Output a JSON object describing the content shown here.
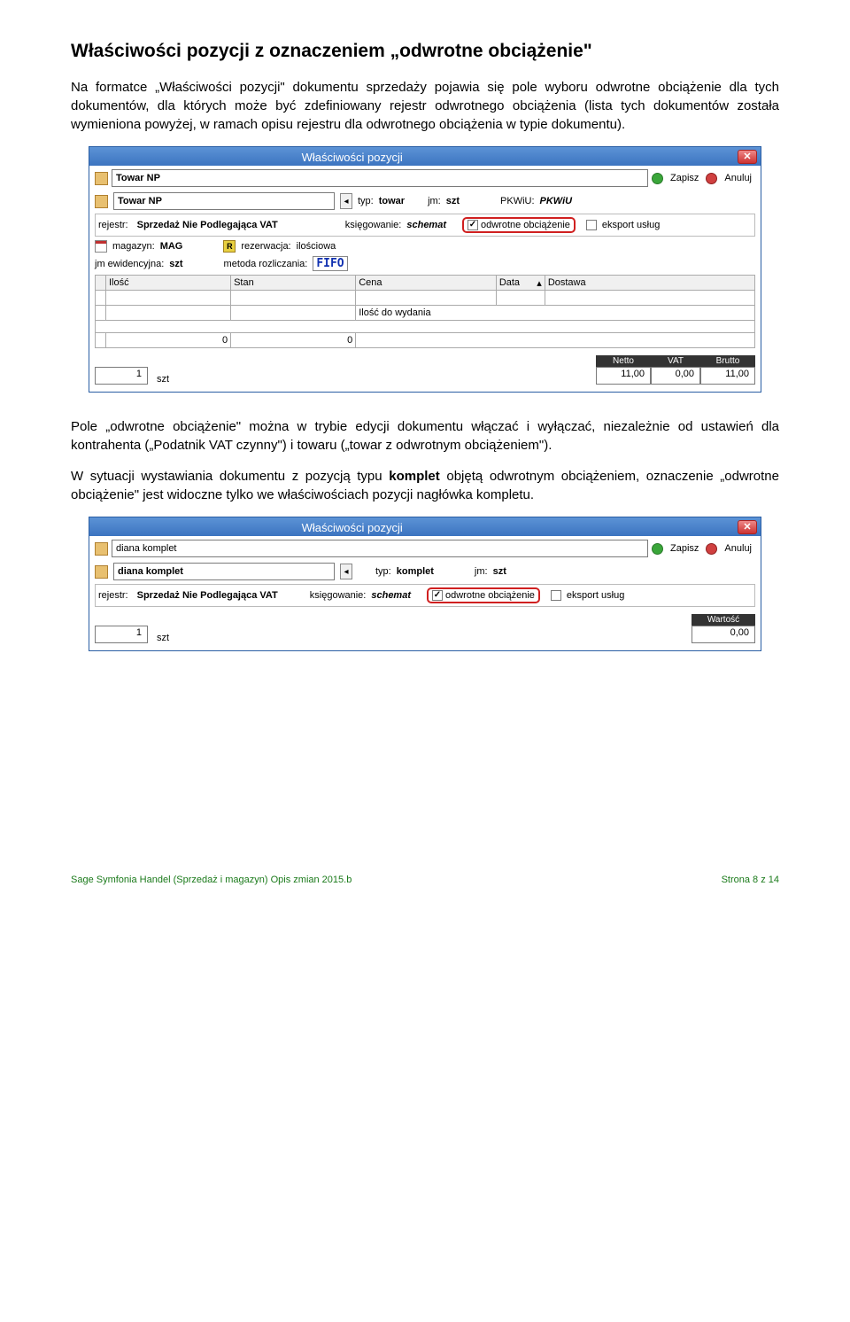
{
  "heading": "Właściwości pozycji z oznaczeniem „odwrotne obciążenie\"",
  "para1": "Na formatce „Właściwości pozycji\" dokumentu sprzedaży pojawia się pole wyboru odwrotne obciążenie dla tych dokumentów, dla których może być zdefiniowany rejestr odwrotnego obciążenia (lista tych dokumentów została wymieniona powyżej, w ramach opisu rejestru dla odwrotnego obciążenia w typie dokumentu).",
  "para2": "Pole „odwrotne obciążenie\" można w trybie edycji dokumentu włączać i wyłączać, niezależnie od ustawień dla kontrahenta („Podatnik VAT czynny\") i towaru („towar z odwrotnym obciążeniem\").",
  "para3_pre": "W sytuacji wystawiania dokumentu z pozycją typu ",
  "para3_b": "komplet",
  "para3_post": " objętą odwrotnym obciążeniem, oznaczenie „odwrotne obciążenie\" jest widoczne tylko we właściwościach pozycji nagłówka kompletu.",
  "win1": {
    "title": "Właściwości pozycji",
    "name": "Towar NP",
    "name2": "Towar NP",
    "save": "Zapisz",
    "cancel": "Anuluj",
    "typ_l": "typ:",
    "typ_v": "towar",
    "jm_l": "jm:",
    "jm_v": "szt",
    "pkwiu_l": "PKWiU:",
    "pkwiu_v": "PKWiU",
    "rej_l": "rejestr:",
    "rej_v": "Sprzedaż Nie Podlegająca VAT",
    "ksg_l": "księgowanie:",
    "ksg_v": "schemat",
    "oo": "odwrotne obciążenie",
    "eu": "eksport usług",
    "mag_l": "magazyn:",
    "mag_v": "MAG",
    "rez_l": "rezerwacja:",
    "rez_v": "ilościowa",
    "jme_l": "jm ewidencyjna:",
    "jme_v": "szt",
    "met_l": "metoda rozliczania:",
    "met_v": "FIFO",
    "th1": "Ilość",
    "th2": "Stan",
    "th3": "Cena",
    "th4": "Data",
    "th5": "Dostawa",
    "row2c3": "Ilość do wydania",
    "sum1": "0",
    "sum2": "0",
    "qty": "1",
    "qtyu": "szt",
    "h_netto": "Netto",
    "h_vat": "VAT",
    "h_brutto": "Brutto",
    "v_netto": "11,00",
    "v_vat": "0,00",
    "v_brutto": "11,00"
  },
  "win2": {
    "title": "Właściwości pozycji",
    "name": "diana komplet",
    "name2": "diana komplet",
    "save": "Zapisz",
    "cancel": "Anuluj",
    "typ_l": "typ:",
    "typ_v": "komplet",
    "jm_l": "jm:",
    "jm_v": "szt",
    "rej_l": "rejestr:",
    "rej_v": "Sprzedaż Nie Podlegająca VAT",
    "ksg_l": "księgowanie:",
    "ksg_v": "schemat",
    "oo": "odwrotne obciążenie",
    "eu": "eksport usług",
    "qty": "1",
    "qtyu": "szt",
    "h_wart": "Wartość",
    "v_wart": "0,00"
  },
  "footer": {
    "left": "Sage Symfonia Handel (Sprzedaż i magazyn) Opis zmian 2015.b",
    "right": "Strona 8 z 14"
  }
}
